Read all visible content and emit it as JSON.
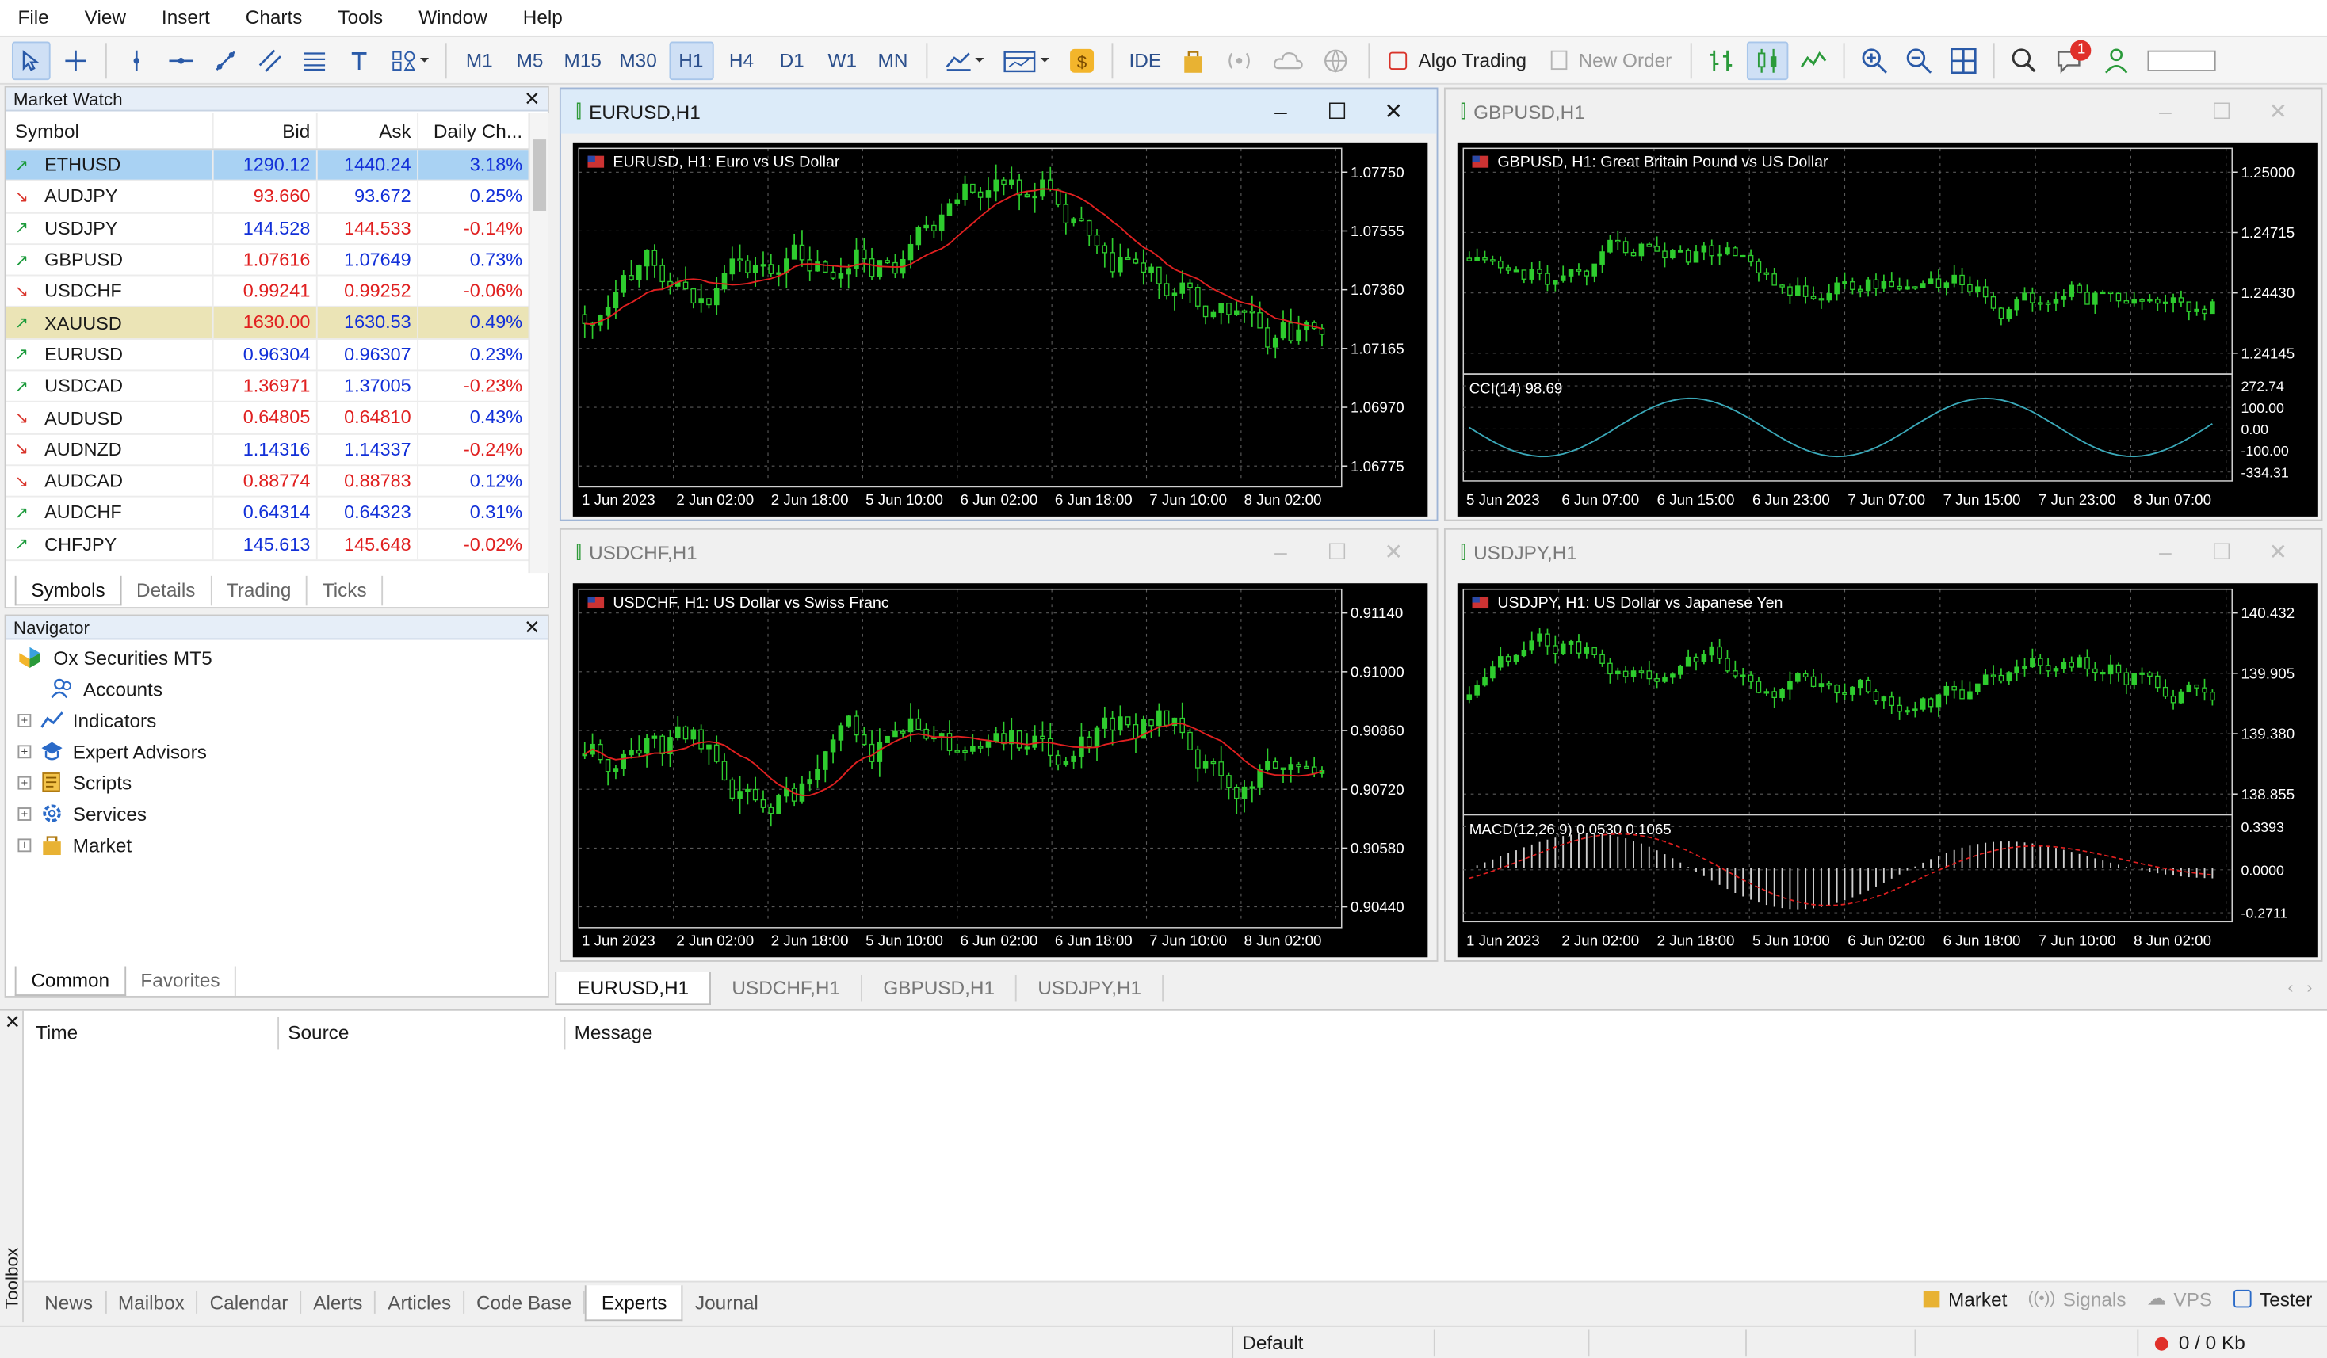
{
  "menu": [
    "File",
    "View",
    "Insert",
    "Charts",
    "Tools",
    "Window",
    "Help"
  ],
  "toolbar": {
    "timeframes": [
      "M1",
      "M5",
      "M15",
      "M30",
      "H1",
      "H4",
      "D1",
      "W1",
      "MN"
    ],
    "active_timeframe": "H1",
    "ide_label": "IDE",
    "algo_trading_label": "Algo Trading",
    "new_order_label": "New Order",
    "notifications_count": "1"
  },
  "market_watch": {
    "title": "Market Watch",
    "columns": [
      "Symbol",
      "Bid",
      "Ask",
      "Daily Ch..."
    ],
    "rows": [
      {
        "symbol": "ETHUSD",
        "dir": "up",
        "bid": "1290.12",
        "ask": "1440.24",
        "change": "3.18%",
        "bid_color": "blue",
        "ask_color": "blue",
        "chg_color": "blue",
        "state": "sel"
      },
      {
        "symbol": "AUDJPY",
        "dir": "dn",
        "bid": "93.660",
        "ask": "93.672",
        "change": "0.25%",
        "bid_color": "red",
        "ask_color": "blue",
        "chg_color": "blue",
        "state": ""
      },
      {
        "symbol": "USDJPY",
        "dir": "up",
        "bid": "144.528",
        "ask": "144.533",
        "change": "-0.14%",
        "bid_color": "blue",
        "ask_color": "red",
        "chg_color": "red",
        "state": ""
      },
      {
        "symbol": "GBPUSD",
        "dir": "up",
        "bid": "1.07616",
        "ask": "1.07649",
        "change": "0.73%",
        "bid_color": "red",
        "ask_color": "blue",
        "chg_color": "blue",
        "state": ""
      },
      {
        "symbol": "USDCHF",
        "dir": "dn",
        "bid": "0.99241",
        "ask": "0.99252",
        "change": "-0.06%",
        "bid_color": "red",
        "ask_color": "red",
        "chg_color": "red",
        "state": ""
      },
      {
        "symbol": "XAUUSD",
        "dir": "up",
        "bid": "1630.00",
        "ask": "1630.53",
        "change": "0.49%",
        "bid_color": "red",
        "ask_color": "blue",
        "chg_color": "blue",
        "state": "hl"
      },
      {
        "symbol": "EURUSD",
        "dir": "up",
        "bid": "0.96304",
        "ask": "0.96307",
        "change": "0.23%",
        "bid_color": "blue",
        "ask_color": "blue",
        "chg_color": "blue",
        "state": ""
      },
      {
        "symbol": "USDCAD",
        "dir": "up",
        "bid": "1.36971",
        "ask": "1.37005",
        "change": "-0.23%",
        "bid_color": "red",
        "ask_color": "blue",
        "chg_color": "red",
        "state": ""
      },
      {
        "symbol": "AUDUSD",
        "dir": "dn",
        "bid": "0.64805",
        "ask": "0.64810",
        "change": "0.43%",
        "bid_color": "red",
        "ask_color": "red",
        "chg_color": "blue",
        "state": ""
      },
      {
        "symbol": "AUDNZD",
        "dir": "dn",
        "bid": "1.14316",
        "ask": "1.14337",
        "change": "-0.24%",
        "bid_color": "blue",
        "ask_color": "blue",
        "chg_color": "red",
        "state": ""
      },
      {
        "symbol": "AUDCAD",
        "dir": "dn",
        "bid": "0.88774",
        "ask": "0.88783",
        "change": "0.12%",
        "bid_color": "red",
        "ask_color": "red",
        "chg_color": "blue",
        "state": ""
      },
      {
        "symbol": "AUDCHF",
        "dir": "up",
        "bid": "0.64314",
        "ask": "0.64323",
        "change": "0.31%",
        "bid_color": "blue",
        "ask_color": "blue",
        "chg_color": "blue",
        "state": ""
      },
      {
        "symbol": "CHFJPY",
        "dir": "up",
        "bid": "145.613",
        "ask": "145.648",
        "change": "-0.02%",
        "bid_color": "blue",
        "ask_color": "red",
        "chg_color": "red",
        "state": ""
      }
    ],
    "tabs": [
      "Symbols",
      "Details",
      "Trading",
      "Ticks"
    ],
    "active_tab": "Symbols"
  },
  "navigator": {
    "title": "Navigator",
    "root": "Ox Securities MT5",
    "items": [
      "Accounts",
      "Indicators",
      "Expert Advisors",
      "Scripts",
      "Services",
      "Market"
    ],
    "tabs": [
      "Common",
      "Favorites"
    ],
    "active_tab": "Common"
  },
  "charts": [
    {
      "title": "EURUSD,H1",
      "desc": "EURUSD, H1:  Euro vs US Dollar",
      "prices": [
        "1.07750",
        "1.07555",
        "1.07360",
        "1.07165",
        "1.06970",
        "1.06775"
      ],
      "times": [
        "1 Jun 2023",
        "2 Jun 02:00",
        "2 Jun 18:00",
        "5 Jun 10:00",
        "6 Jun 02:00",
        "6 Jun 18:00",
        "7 Jun 10:00",
        "8 Jun 02:00"
      ],
      "indicator": "",
      "indicator_levels": []
    },
    {
      "title": "GBPUSD,H1",
      "desc": "GBPUSD, H1:  Great Britain Pound vs US Dollar",
      "prices": [
        "1.25000",
        "1.24715",
        "1.24430",
        "1.24145"
      ],
      "times": [
        "5 Jun 2023",
        "6 Jun 07:00",
        "6 Jun 15:00",
        "6 Jun 23:00",
        "7 Jun 07:00",
        "7 Jun 15:00",
        "7 Jun 23:00",
        "8 Jun 07:00"
      ],
      "indicator": "CCI(14) 98.69",
      "indicator_levels": [
        "272.74",
        "100.00",
        "0.00",
        "-100.00",
        "-334.31"
      ]
    },
    {
      "title": "USDCHF,H1",
      "desc": "USDCHF, H1:  US Dollar vs Swiss Franc",
      "prices": [
        "0.91140",
        "0.91000",
        "0.90860",
        "0.90720",
        "0.90580",
        "0.90440"
      ],
      "times": [
        "1 Jun 2023",
        "2 Jun 02:00",
        "2 Jun 18:00",
        "5 Jun 10:00",
        "6 Jun 02:00",
        "6 Jun 18:00",
        "7 Jun 10:00",
        "8 Jun 02:00"
      ],
      "indicator": "",
      "indicator_levels": []
    },
    {
      "title": "USDJPY,H1",
      "desc": "USDJPY, H1:  US Dollar vs Japanese Yen",
      "prices": [
        "140.432",
        "139.905",
        "139.380",
        "138.855"
      ],
      "times": [
        "1 Jun 2023",
        "2 Jun 02:00",
        "2 Jun 18:00",
        "5 Jun 10:00",
        "6 Jun 02:00",
        "6 Jun 18:00",
        "7 Jun 10:00",
        "8 Jun 02:00"
      ],
      "indicator": "MACD(12,26,9) 0.0530 0.1065",
      "indicator_levels": [
        "0.3393",
        "0.0000",
        "-0.2711"
      ]
    }
  ],
  "chart_tabs": [
    "EURUSD,H1",
    "USDCHF,H1",
    "GBPUSD,H1",
    "USDJPY,H1"
  ],
  "active_chart_tab": "EURUSD,H1",
  "toolbox": {
    "label": "Toolbox",
    "columns": [
      "Time",
      "Source",
      "Message"
    ],
    "tabs": [
      "News",
      "Mailbox",
      "Calendar",
      "Alerts",
      "Articles",
      "Code Base",
      "Experts",
      "Journal"
    ],
    "active_tab": "Experts",
    "right": [
      "Market",
      "Signals",
      "VPS",
      "Tester"
    ]
  },
  "status": {
    "profile": "Default",
    "traffic": "0 / 0 Kb"
  },
  "colors": {
    "up_arrow": "#1a9a3a",
    "down_arrow": "#d9342b",
    "bid_blue": "#1230d8",
    "bid_red": "#e02020",
    "candle": "#2ecc2e",
    "ma_line": "#e02020",
    "cci_line": "#3aa8b8"
  }
}
